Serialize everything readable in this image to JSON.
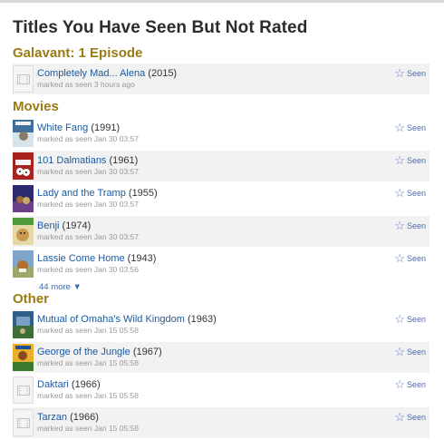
{
  "page": {
    "title": "Titles You Have Seen But Not Rated"
  },
  "sections": {
    "galavant": {
      "title": "Galavant: 1 Episode",
      "items": [
        {
          "title": "Completely Mad... Alena",
          "year": "(2015)",
          "sub": "marked as seen 3 hours ago",
          "seen_label": "Seen"
        }
      ]
    },
    "movies": {
      "title": "Movies",
      "items": [
        {
          "title": "White Fang",
          "year": "(1991)",
          "sub": "marked as seen Jan 30 03:57",
          "seen_label": "Seen"
        },
        {
          "title": "101 Dalmatians",
          "year": "(1961)",
          "sub": "marked as seen Jan 30 03:57",
          "seen_label": "Seen"
        },
        {
          "title": "Lady and the Tramp",
          "year": "(1955)",
          "sub": "marked as seen Jan 30 03:57",
          "seen_label": "Seen"
        },
        {
          "title": "Benji",
          "year": "(1974)",
          "sub": "marked as seen Jan 30 03:57",
          "seen_label": "Seen"
        },
        {
          "title": "Lassie Come Home",
          "year": "(1943)",
          "sub": "marked as seen Jan 30 03:56",
          "seen_label": "Seen"
        }
      ],
      "more_label": "44 more ▼"
    },
    "other": {
      "title": "Other",
      "items": [
        {
          "title": "Mutual of Omaha's Wild Kingdom",
          "year": "(1963)",
          "sub": "marked as seen Jan 15 05:58",
          "seen_label": "Seen"
        },
        {
          "title": "George of the Jungle",
          "year": "(1967)",
          "sub": "marked as seen Jan 15 05:58",
          "seen_label": "Seen"
        },
        {
          "title": "Daktari",
          "year": "(1966)",
          "sub": "marked as seen Jan 15 05:58",
          "seen_label": "Seen"
        },
        {
          "title": "Tarzan",
          "year": "(1966)",
          "sub": "marked as seen Jan 15 05:58",
          "seen_label": "Seen"
        }
      ]
    }
  },
  "icons": {
    "seen": "star-outline-icon",
    "placeholder": "film-placeholder-icon"
  },
  "colors": {
    "section_title": "#9a7a12",
    "link": "#1b5aa0",
    "seen": "#4a6ab0"
  }
}
